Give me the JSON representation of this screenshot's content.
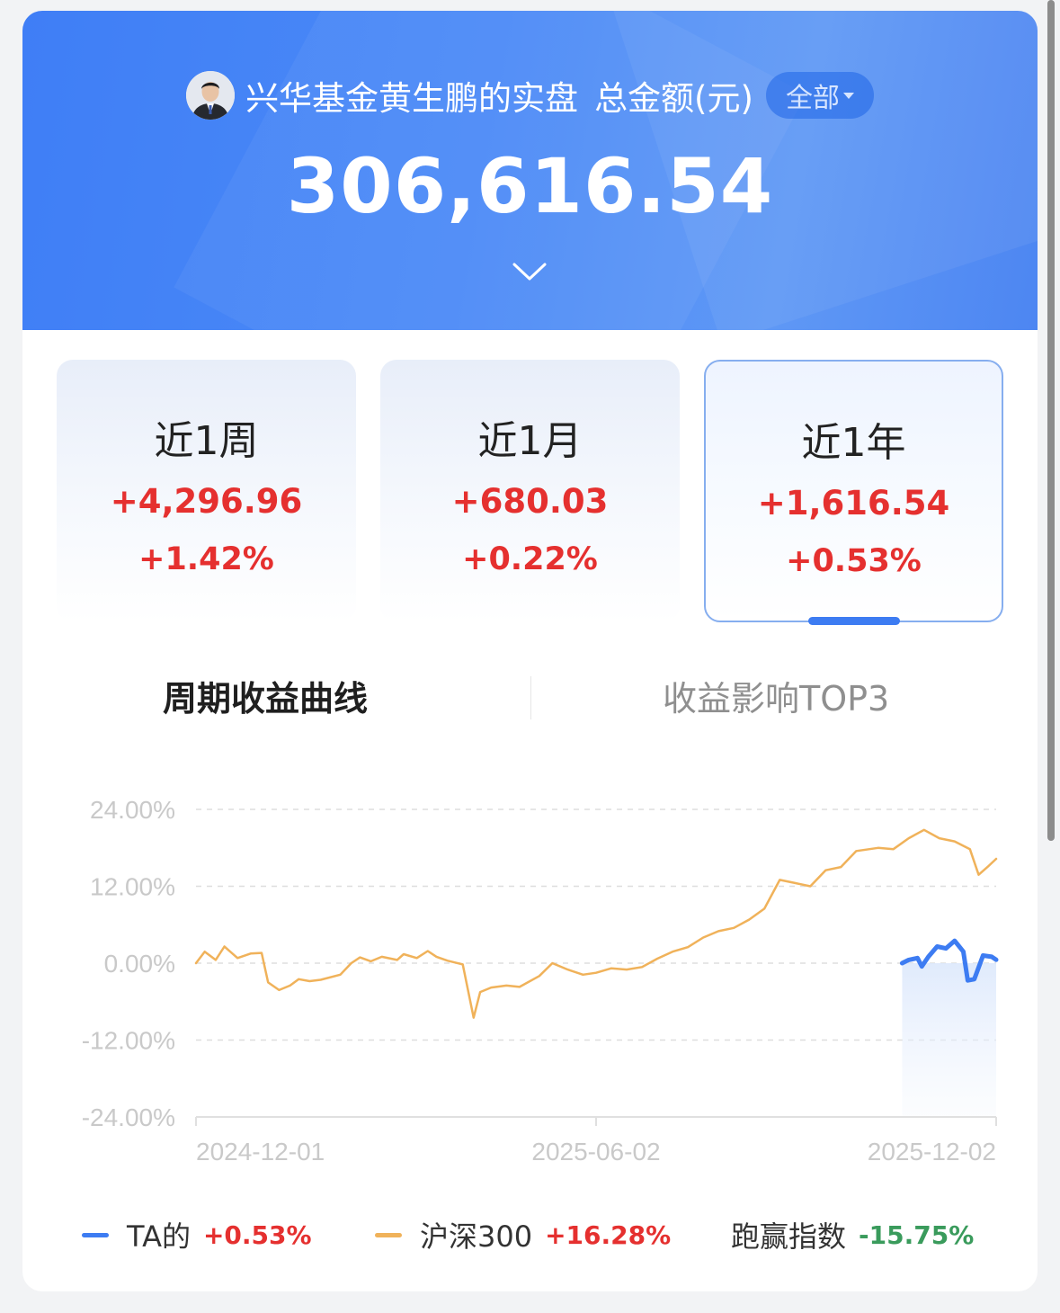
{
  "header": {
    "owner_name": "兴华基金黄生鹏的实盘",
    "total_label": "总金额(元)",
    "scope_selector": "全部",
    "total_amount": "306,616.54"
  },
  "periods": [
    {
      "label": "近1周",
      "amount": "+4,296.96",
      "percent": "+1.42%"
    },
    {
      "label": "近1月",
      "amount": "+680.03",
      "percent": "+0.22%"
    },
    {
      "label": "近1年",
      "amount": "+1,616.54",
      "percent": "+0.53%",
      "selected": true
    }
  ],
  "tabs": [
    {
      "label": "周期收益曲线",
      "active": true
    },
    {
      "label": "收益影响TOP3",
      "active": false
    }
  ],
  "legend": [
    {
      "name": "TA的",
      "value": "+0.53%",
      "color": "#3d7cf2",
      "trend": "up"
    },
    {
      "name": "沪深300",
      "value": "+16.28%",
      "color": "#f0b25a",
      "trend": "up"
    },
    {
      "name": "跑赢指数",
      "value": "-15.75%",
      "trend": "down"
    }
  ],
  "chart_data": {
    "type": "line",
    "y_tick_labels": [
      "24.00%",
      "12.00%",
      "0.00%",
      "-12.00%",
      "-24.00%"
    ],
    "x_tick_labels": [
      "2024-12-01",
      "2025-06-02",
      "2025-12-02"
    ],
    "ylim": [
      -24,
      24
    ],
    "xlim": [
      "2024-12-01",
      "2025-12-02"
    ],
    "grid": true,
    "series": [
      {
        "name": "沪深300",
        "color": "#f0b25a",
        "points": [
          [
            "2024-12-01",
            0.0
          ],
          [
            "2024-12-05",
            1.8
          ],
          [
            "2024-12-10",
            0.5
          ],
          [
            "2024-12-14",
            2.6
          ],
          [
            "2024-12-20",
            0.8
          ],
          [
            "2024-12-26",
            1.5
          ],
          [
            "2024-12-31",
            1.6
          ],
          [
            "2025-01-03",
            -3.0
          ],
          [
            "2025-01-08",
            -4.2
          ],
          [
            "2025-01-13",
            -3.5
          ],
          [
            "2025-01-17",
            -2.5
          ],
          [
            "2025-01-22",
            -2.8
          ],
          [
            "2025-01-27",
            -2.6
          ],
          [
            "2025-02-05",
            -1.8
          ],
          [
            "2025-02-10",
            0.0
          ],
          [
            "2025-02-14",
            0.9
          ],
          [
            "2025-02-19",
            0.3
          ],
          [
            "2025-02-24",
            1.0
          ],
          [
            "2025-03-03",
            0.5
          ],
          [
            "2025-03-06",
            1.4
          ],
          [
            "2025-03-12",
            0.8
          ],
          [
            "2025-03-17",
            1.9
          ],
          [
            "2025-03-21",
            1.0
          ],
          [
            "2025-03-26",
            0.4
          ],
          [
            "2025-04-02",
            -0.2
          ],
          [
            "2025-04-07",
            -8.5
          ],
          [
            "2025-04-10",
            -4.5
          ],
          [
            "2025-04-15",
            -3.8
          ],
          [
            "2025-04-22",
            -3.5
          ],
          [
            "2025-04-28",
            -3.7
          ],
          [
            "2025-05-07",
            -2.0
          ],
          [
            "2025-05-13",
            0.0
          ],
          [
            "2025-05-20",
            -1.0
          ],
          [
            "2025-05-27",
            -1.8
          ],
          [
            "2025-06-02",
            -1.5
          ],
          [
            "2025-06-09",
            -0.8
          ],
          [
            "2025-06-16",
            -1.0
          ],
          [
            "2025-06-23",
            -0.6
          ],
          [
            "2025-06-30",
            0.7
          ],
          [
            "2025-07-07",
            1.8
          ],
          [
            "2025-07-14",
            2.5
          ],
          [
            "2025-07-21",
            4.0
          ],
          [
            "2025-07-28",
            5.0
          ],
          [
            "2025-08-04",
            5.5
          ],
          [
            "2025-08-11",
            6.8
          ],
          [
            "2025-08-18",
            8.5
          ],
          [
            "2025-08-25",
            13.0
          ],
          [
            "2025-09-01",
            12.5
          ],
          [
            "2025-09-08",
            12.0
          ],
          [
            "2025-09-15",
            14.5
          ],
          [
            "2025-09-22",
            15.0
          ],
          [
            "2025-09-29",
            17.5
          ],
          [
            "2025-10-09",
            18.0
          ],
          [
            "2025-10-16",
            17.8
          ],
          [
            "2025-10-23",
            19.5
          ],
          [
            "2025-10-30",
            20.8
          ],
          [
            "2025-11-06",
            19.5
          ],
          [
            "2025-11-13",
            19.0
          ],
          [
            "2025-11-20",
            17.8
          ],
          [
            "2025-11-24",
            13.8
          ],
          [
            "2025-11-28",
            15.0
          ],
          [
            "2025-12-02",
            16.28
          ]
        ]
      },
      {
        "name": "TA的",
        "color": "#3d7cf2",
        "points": [
          [
            "2025-10-20",
            0.0
          ],
          [
            "2025-10-23",
            0.5
          ],
          [
            "2025-10-27",
            0.8
          ],
          [
            "2025-10-29",
            -0.5
          ],
          [
            "2025-11-01",
            1.0
          ],
          [
            "2025-11-05",
            2.6
          ],
          [
            "2025-11-09",
            2.3
          ],
          [
            "2025-11-13",
            3.5
          ],
          [
            "2025-11-17",
            1.8
          ],
          [
            "2025-11-19",
            -2.7
          ],
          [
            "2025-11-22",
            -2.5
          ],
          [
            "2025-11-26",
            1.2
          ],
          [
            "2025-11-30",
            1.0
          ],
          [
            "2025-12-02",
            0.53
          ]
        ]
      }
    ]
  }
}
